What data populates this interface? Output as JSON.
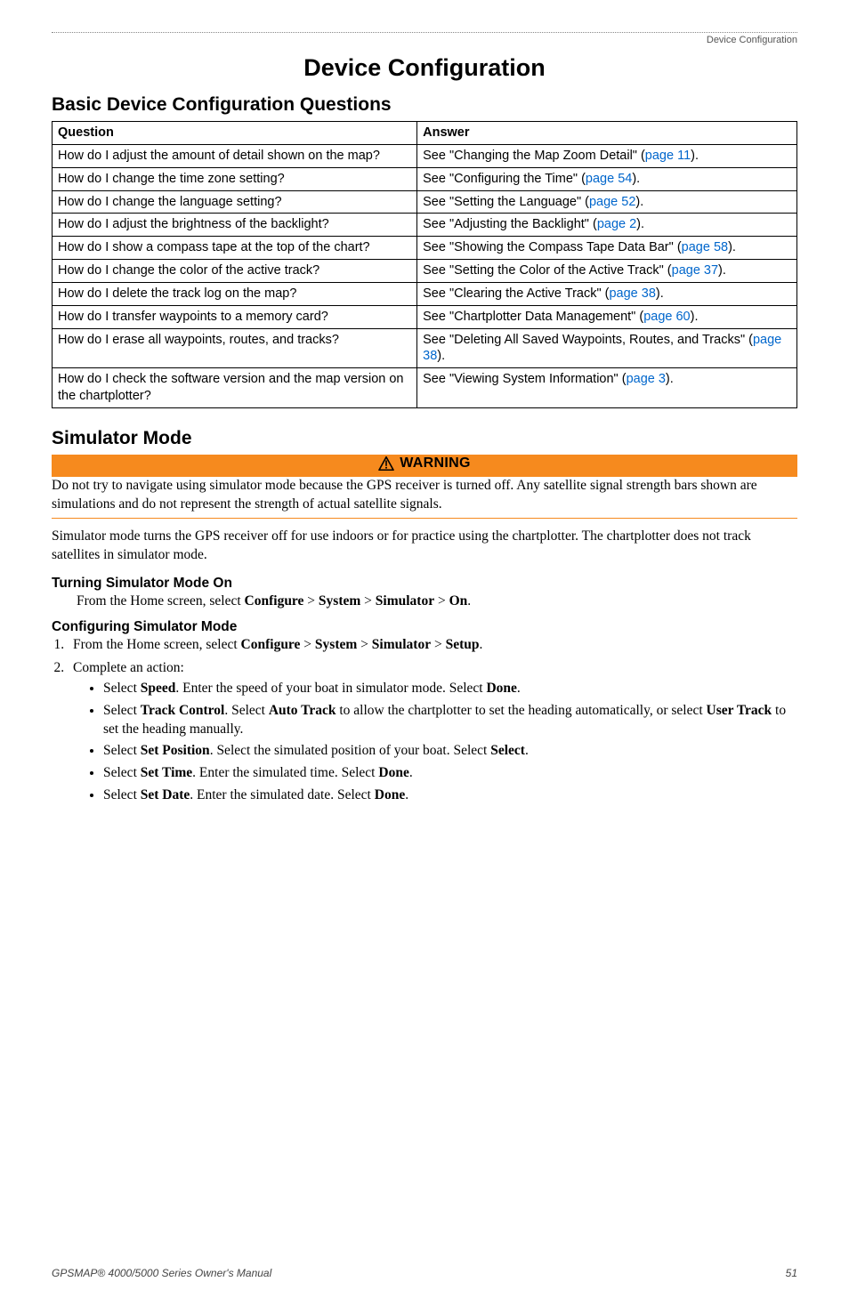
{
  "breadcrumb": "Device Configuration",
  "page_title": "Device Configuration",
  "basic_section_title": "Basic Device Configuration Questions",
  "table": {
    "headers": {
      "q": "Question",
      "a": "Answer"
    },
    "rows": [
      {
        "q": "How do I adjust the amount of detail shown on the map?",
        "a_pre": "See \"Changing the Map Zoom Detail\" (",
        "a_link": "page 11",
        "a_post": ")."
      },
      {
        "q": "How do I change the time zone setting?",
        "a_pre": "See \"Configuring the Time\" (",
        "a_link": "page 54",
        "a_post": ")."
      },
      {
        "q": "How do I change the language setting?",
        "a_pre": "See \"Setting the Language\" (",
        "a_link": "page 52",
        "a_post": ")."
      },
      {
        "q": "How do I adjust the brightness of the backlight?",
        "a_pre": "See \"Adjusting the Backlight\" (",
        "a_link": "page 2",
        "a_post": ")."
      },
      {
        "q": "How do I show a compass tape at the top of the chart?",
        "a_pre": "See \"Showing the Compass Tape Data Bar\" (",
        "a_link": "page 58",
        "a_post": ")."
      },
      {
        "q": "How do I change the color of the active track?",
        "a_pre": "See \"Setting the Color of the Active Track\" (",
        "a_link": "page 37",
        "a_post": ")."
      },
      {
        "q": "How do I delete the track log on the map?",
        "a_pre": "See \"Clearing the Active Track\" (",
        "a_link": "page 38",
        "a_post": ")."
      },
      {
        "q": "How do I transfer waypoints to a memory card?",
        "a_pre": "See \"Chartplotter Data Management\" (",
        "a_link": "page 60",
        "a_post": ")."
      },
      {
        "q": "How do I erase all waypoints, routes, and tracks?",
        "a_pre": "See \"Deleting All Saved Waypoints, Routes, and Tracks\" (",
        "a_link": "page 38",
        "a_post": ")."
      },
      {
        "q": "How do I check the software version and the map version on the chartplotter?",
        "a_pre": "See \"Viewing System Information\" (",
        "a_link": "page 3",
        "a_post": ")."
      }
    ]
  },
  "simulator_title": "Simulator Mode",
  "warning_label": "WARNING",
  "warning_text": "Do not try to navigate using simulator mode because the GPS receiver is turned off. Any satellite signal strength bars shown are simulations and do not represent the strength of actual satellite signals.",
  "simulator_body": "Simulator mode turns the GPS receiver off for use indoors or for practice using the chartplotter. The chartplotter does not track satellites in simulator mode.",
  "turn_on_head": "Turning Simulator Mode On",
  "turn_on_line_pre": "From the Home screen, select ",
  "turn_on_seq": [
    "Configure",
    "System",
    "Simulator",
    "On"
  ],
  "config_head": "Configuring Simulator Mode",
  "step1_pre": "From the Home screen, select ",
  "step1_seq": [
    "Configure",
    "System",
    "Simulator",
    "Setup"
  ],
  "step2_text": "Complete an action:",
  "bullets": {
    "b1": {
      "pre": "Select ",
      "bold1": "Speed",
      "mid1": ". Enter the speed of your boat in simulator mode. Select ",
      "bold2": "Done",
      "post": "."
    },
    "b2": {
      "pre": "Select ",
      "bold1": "Track Control",
      "mid1": ". Select ",
      "bold2": "Auto Track",
      "mid2": " to allow the chartplotter to set the heading automatically, or select ",
      "bold3": "User Track",
      "post": " to set the heading manually."
    },
    "b3": {
      "pre": "Select ",
      "bold1": "Set Position",
      "mid1": ". Select the simulated position of your boat. Select ",
      "bold2": "Select",
      "post": "."
    },
    "b4": {
      "pre": "Select ",
      "bold1": "Set Time",
      "mid1": ". Enter the simulated time. Select ",
      "bold2": "Done",
      "post": "."
    },
    "b5": {
      "pre": "Select ",
      "bold1": "Set Date",
      "mid1": ". Enter the simulated date. Select ",
      "bold2": "Done",
      "post": "."
    }
  },
  "footer_left": "GPSMAP® 4000/5000 Series Owner's Manual",
  "footer_page": "51",
  "gt": ">"
}
